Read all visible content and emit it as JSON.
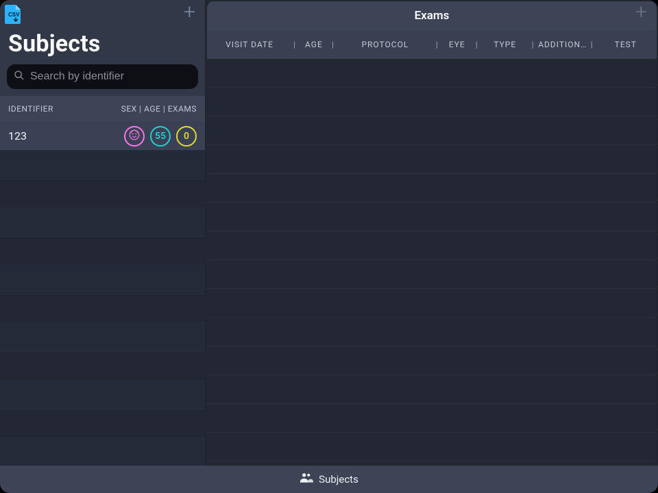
{
  "sidebar": {
    "title": "Subjects",
    "search_placeholder": "Search by identifier",
    "col_identifier": "IDENTIFIER",
    "col_meta": "SEX | AGE | EXAMS",
    "csv_label": "CSV"
  },
  "subject": {
    "identifier": "123",
    "age": "55",
    "exams_count": "0"
  },
  "exams": {
    "title": "Exams",
    "cols": {
      "visit_date": "VISIT DATE",
      "age": "AGE",
      "protocol": "PROTOCOL",
      "eye": "EYE",
      "type": "TYPE",
      "additional": "ADDITION…",
      "test": "TEST"
    }
  },
  "bottom": {
    "label": "Subjects"
  }
}
